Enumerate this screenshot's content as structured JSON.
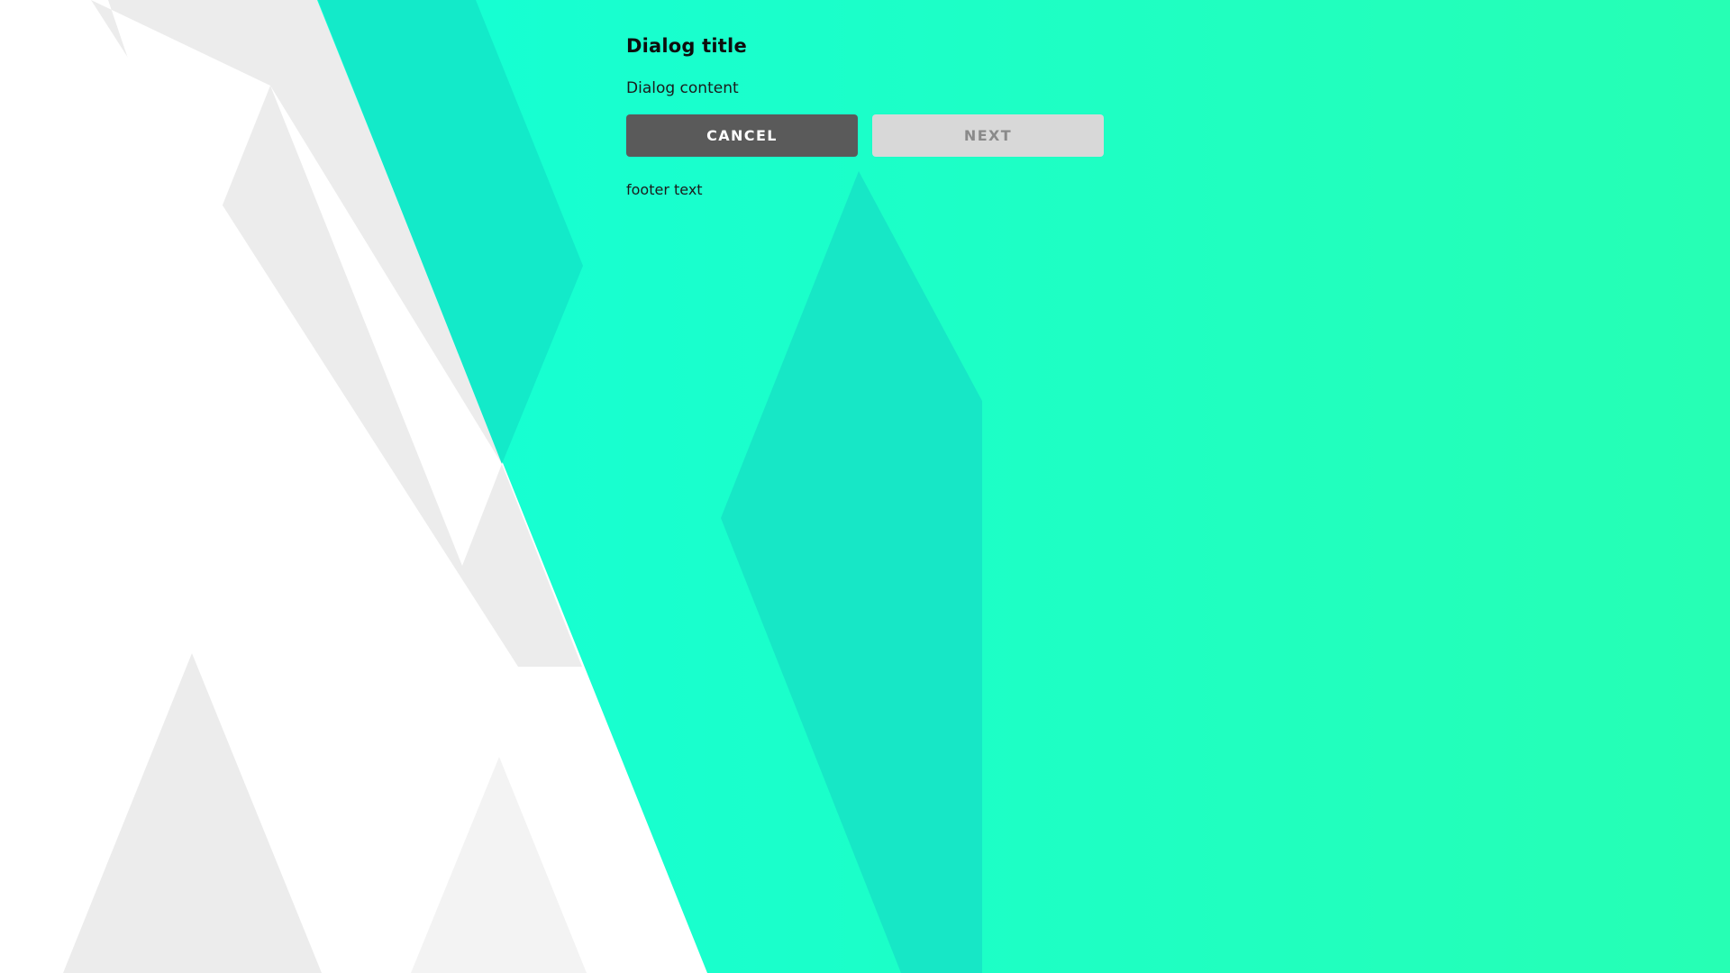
{
  "theme": {
    "accent_start": "#14ffd6",
    "accent_end": "#26ffb4",
    "cancel_button_color": "#5a5a5a",
    "next_button_color": "#d8d8d8"
  },
  "dialog": {
    "title": "Dialog title",
    "content": "Dialog content",
    "buttons": {
      "cancel_label": "CANCEL",
      "next_label": "NEXT",
      "next_disabled": true
    },
    "footer": "footer text"
  }
}
